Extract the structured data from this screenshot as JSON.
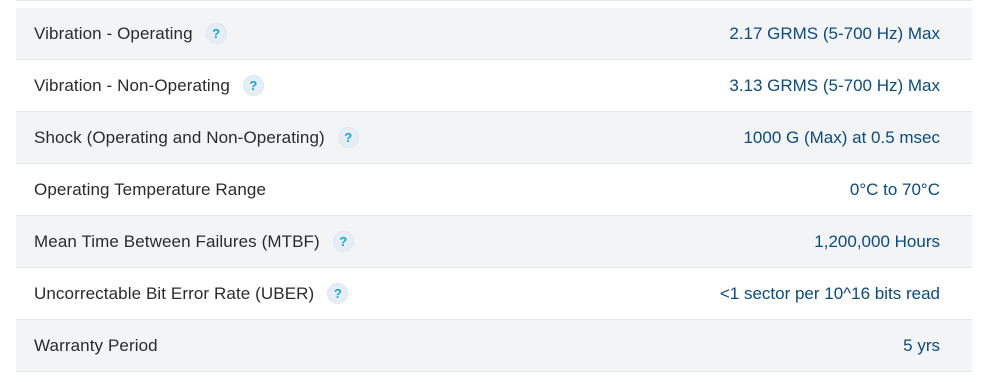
{
  "colors": {
    "label_text": "#2b2b2b",
    "value_text": "#0a4b82",
    "help_icon": "#16a3d9",
    "row_stripe": "#f3f4f6"
  },
  "help_icon": {
    "glyph": "?",
    "icon_name": "help-icon"
  },
  "specs": [
    {
      "label": "Vibration - Operating",
      "value": "2.17 GRMS (5-700 Hz) Max",
      "has_help": true
    },
    {
      "label": "Vibration - Non-Operating",
      "value": "3.13 GRMS (5-700 Hz) Max",
      "has_help": true
    },
    {
      "label": "Shock (Operating and Non-Operating)",
      "value": "1000 G (Max) at 0.5 msec",
      "has_help": true
    },
    {
      "label": "Operating Temperature Range",
      "value": "0°C to 70°C",
      "has_help": false
    },
    {
      "label": "Mean Time Between Failures (MTBF)",
      "value": "1,200,000 Hours",
      "has_help": true
    },
    {
      "label": "Uncorrectable Bit Error Rate (UBER)",
      "value": "<1 sector per 10^16 bits read",
      "has_help": true
    },
    {
      "label": "Warranty Period",
      "value": "5 yrs",
      "has_help": false
    }
  ]
}
